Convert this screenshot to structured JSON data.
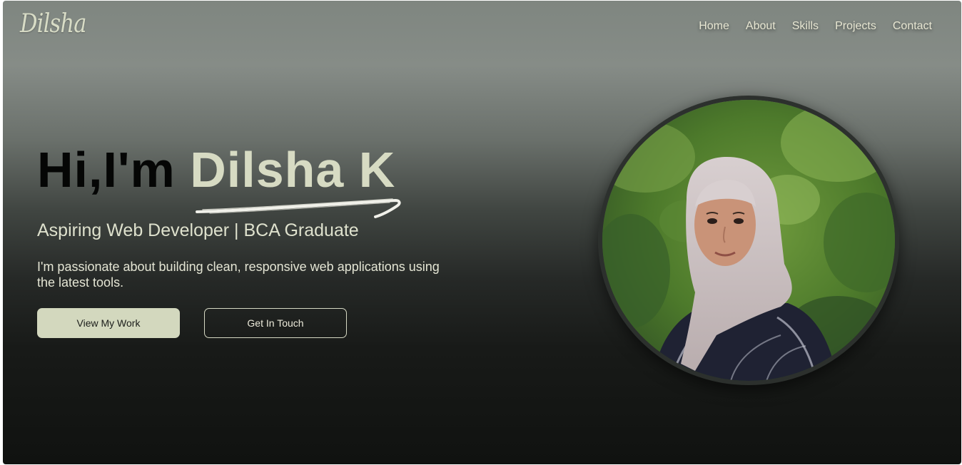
{
  "brand": {
    "logo": "Dilsha"
  },
  "nav": {
    "items": [
      "Home",
      "About",
      "Skills",
      "Projects",
      "Contact"
    ]
  },
  "hero": {
    "greeting": "Hi,I'm",
    "name": "Dilsha K",
    "subtitle": "Aspiring Web Developer | BCA Graduate",
    "description": "I'm passionate about building clean, responsive web applications using the latest tools.",
    "primary_button": "View My Work",
    "secondary_button": "Get In Touch"
  },
  "colors": {
    "accent": "#d3d8be",
    "name_text": "#d7dbc3",
    "background_top": "#868c87",
    "background_bottom": "#101210"
  },
  "icons": {
    "underline": "brush-stroke-underline"
  }
}
